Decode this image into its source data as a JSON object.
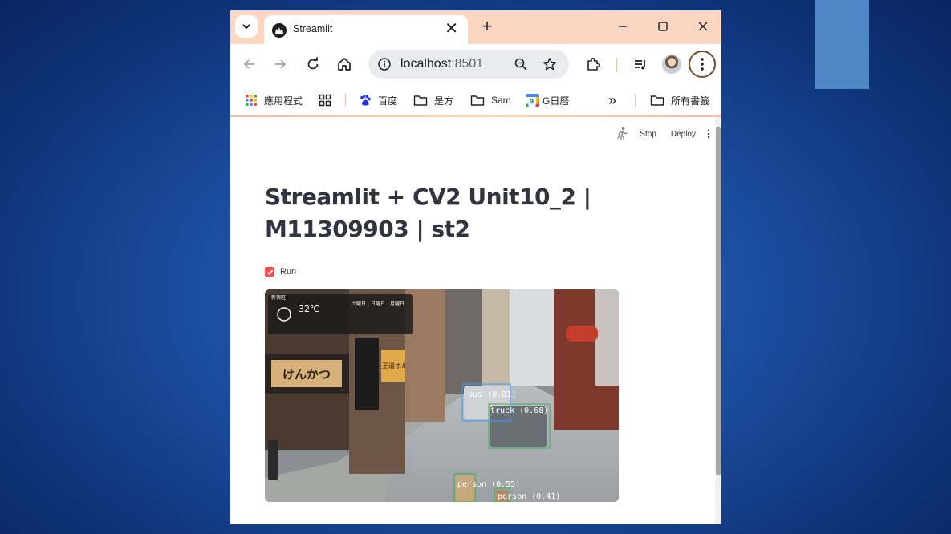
{
  "browser": {
    "tab_title": "Streamlit",
    "new_tab_glyph": "+",
    "tab_close_glyph": "✕",
    "url_host": "localhost",
    "url_port": ":8501",
    "icons": [
      "tab-list-icon",
      "streamlit-favicon",
      "close-icon",
      "new-tab-icon",
      "minimize-icon",
      "maximize-icon",
      "window-close-icon",
      "back-icon",
      "forward-icon",
      "reload-icon",
      "home-icon",
      "site-info-icon",
      "zoom-icon",
      "bookmark-star-icon",
      "extensions-icon",
      "media-icon",
      "profile-avatar",
      "menu-icon"
    ]
  },
  "bookmarks": {
    "apps": "應用程式",
    "baidu": "百度",
    "shifang": "是方",
    "sam": "Sam",
    "gcal": "G日曆",
    "more_glyph": "»",
    "all_bookmarks": "所有書籤"
  },
  "streamlit": {
    "header": {
      "stop_label": "Stop",
      "deploy_label": "Deploy"
    },
    "title": "Streamlit + CV2 Unit10_2 | M11309903 | st2",
    "checkbox": {
      "label": "Run",
      "checked": true
    },
    "frame": {
      "weather": {
        "temperature": "32℃",
        "days": [
          "土曜日",
          "日曜日",
          "月曜日"
        ]
      },
      "district_label": "新宿区",
      "detections": [
        {
          "label": "bus (0.81)",
          "color": "#3b9cff"
        },
        {
          "label": "truck (0.68)",
          "color": "#37b34a"
        },
        {
          "label": "person (0.55)",
          "color": "#37b34a"
        },
        {
          "label": "person (0.41)",
          "color": "#37b34a"
        }
      ],
      "shop_signs": [
        "けんかつ",
        "王道ホルモン"
      ]
    }
  },
  "colors": {
    "accent": "#ff4b4b",
    "tabbar": "#fbd6c1",
    "text": "#31333f"
  }
}
